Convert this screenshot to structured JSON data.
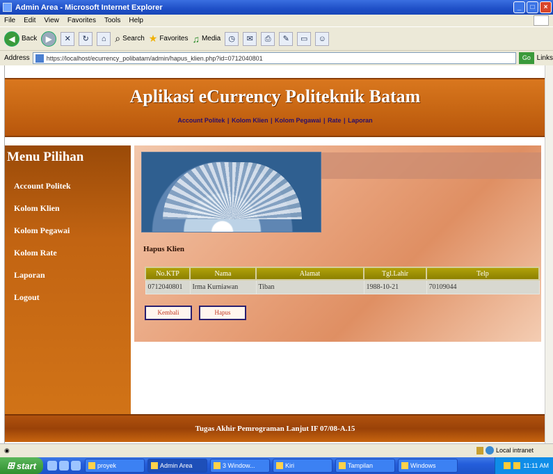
{
  "window": {
    "title": "Admin Area - Microsoft Internet Explorer",
    "min": "_",
    "max": "□",
    "close": "×"
  },
  "menubar": [
    "File",
    "Edit",
    "View",
    "Favorites",
    "Tools",
    "Help"
  ],
  "toolbar": {
    "back_label": "Back",
    "search_label": "Search",
    "favorites_label": "Favorites",
    "media_label": "Media"
  },
  "address": {
    "label": "Address",
    "url": "https://localhost/ecurrency_polibatam/admin/hapus_klien.php?id=0712040801",
    "go_label": "Go",
    "links_label": "Links"
  },
  "page": {
    "title": "Aplikasi eCurrency Politeknik Batam",
    "nav": [
      "Account Politek",
      "Kolom Klien",
      "Kolom Pegawai",
      "Rate",
      "Laporan"
    ],
    "sidebar_title": "Menu Pilihan",
    "sidebar_items": [
      "Account Politek",
      "Kolom Klien",
      "Kolom Pegawai",
      "Kolom Rate",
      "Laporan",
      "Logout"
    ],
    "section_title": "Hapus Klien",
    "table": {
      "headers": [
        "No.KTP",
        "Nama",
        "Alamat",
        "Tgl.Lahir",
        "Telp"
      ],
      "rows": [
        [
          "0712040801",
          "Irma Kurniawan",
          "Tiban",
          "1988-10-21",
          "70109044"
        ]
      ]
    },
    "buttons": {
      "back": "Kembali",
      "delete": "Hapus"
    },
    "footer": "Tugas Akhir Pemrograman Lanjut IF 07/08-A.15"
  },
  "statusbar": {
    "zone": "Local intranet"
  },
  "taskbar": {
    "start": "start",
    "items": [
      "proyek",
      "Admin Area",
      "3 Window...",
      "Kiri",
      "Tampilan",
      "Windows"
    ],
    "clock": "11:11 AM"
  }
}
